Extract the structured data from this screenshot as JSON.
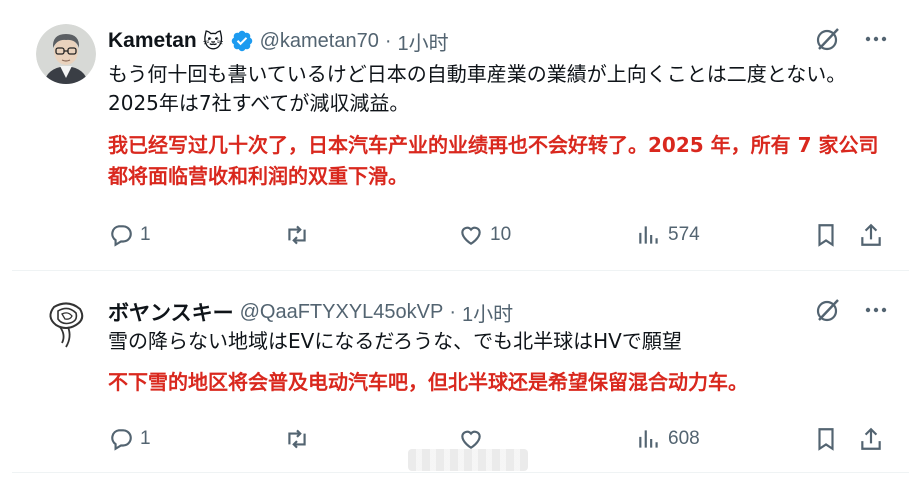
{
  "tweets": [
    {
      "author": {
        "name": "Kametan",
        "emoji": "🐱",
        "handle": "@kametan70",
        "time": "1小时"
      },
      "text_jp": "もう何十回も書いているけど日本の自動車産業の業績が上向くことは二度とない。2025年は7社すべてが減収減益。",
      "text_cn": "我已经写过几十次了，日本汽车产业的业绩再也不会好转了。2025 年，所有 7 家公司都将面临营收和利润的双重下滑。",
      "stats": {
        "replies": "1",
        "retweets": "",
        "likes": "10",
        "views": "574"
      }
    },
    {
      "author": {
        "name": "ボヤンスキー",
        "handle": "@QaaFTYXYL45okVP",
        "time": "1小时"
      },
      "text_jp": "雪の降らない地域はEVになるだろうな、でも北半球はHVで願望",
      "text_cn": "不下雪的地区将会普及电动汽车吧，但北半球还是希望保留混合动力车。",
      "stats": {
        "replies": "1",
        "retweets": "",
        "likes": "",
        "views": "608"
      }
    }
  ],
  "dot": "·",
  "colors": {
    "verified": "#1d9bf0",
    "muted": "#536471",
    "translation": "#d9281e"
  },
  "icons": [
    "grok-icon",
    "more-icon",
    "reply-icon",
    "retweet-icon",
    "like-icon",
    "views-icon",
    "bookmark-icon",
    "share-icon",
    "verified-badge-icon"
  ]
}
